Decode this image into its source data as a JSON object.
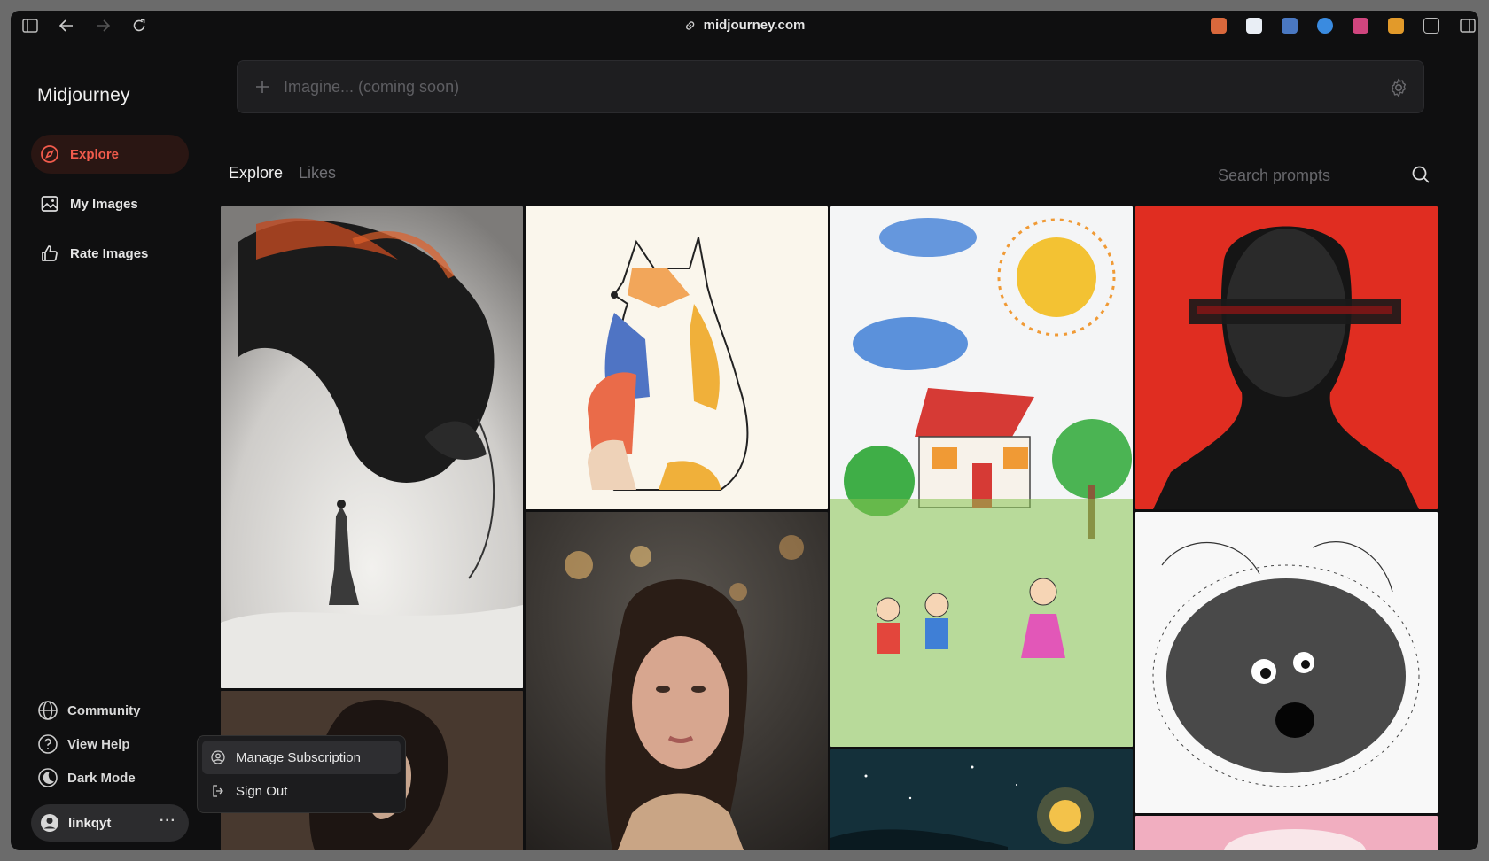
{
  "browser": {
    "url": "midjourney.com"
  },
  "sidebar": {
    "brand": "Midjourney",
    "nav": [
      {
        "label": "Explore",
        "icon": "compass-icon",
        "active": true
      },
      {
        "label": "My Images",
        "icon": "image-icon",
        "active": false
      },
      {
        "label": "Rate Images",
        "icon": "thumbs-up-icon",
        "active": false
      }
    ],
    "footer": [
      {
        "label": "Community",
        "icon": "globe-icon"
      },
      {
        "label": "View Help",
        "icon": "help-circle-icon"
      },
      {
        "label": "Dark Mode",
        "icon": "moon-icon"
      }
    ],
    "user": {
      "name": "linkqyt",
      "more": "···"
    }
  },
  "user_menu": {
    "items": [
      {
        "label": "Manage Subscription",
        "icon": "user-circle-icon"
      },
      {
        "label": "Sign Out",
        "icon": "sign-out-icon"
      }
    ]
  },
  "prompt": {
    "placeholder": "Imagine... (coming soon)"
  },
  "main": {
    "tabs": [
      {
        "label": "Explore",
        "active": true
      },
      {
        "label": "Likes",
        "active": false
      }
    ],
    "search_placeholder": "Search prompts"
  },
  "colors": {
    "accent": "#f15b4c",
    "background": "#0f0f10",
    "active_nav_bg": "#2a1613"
  }
}
